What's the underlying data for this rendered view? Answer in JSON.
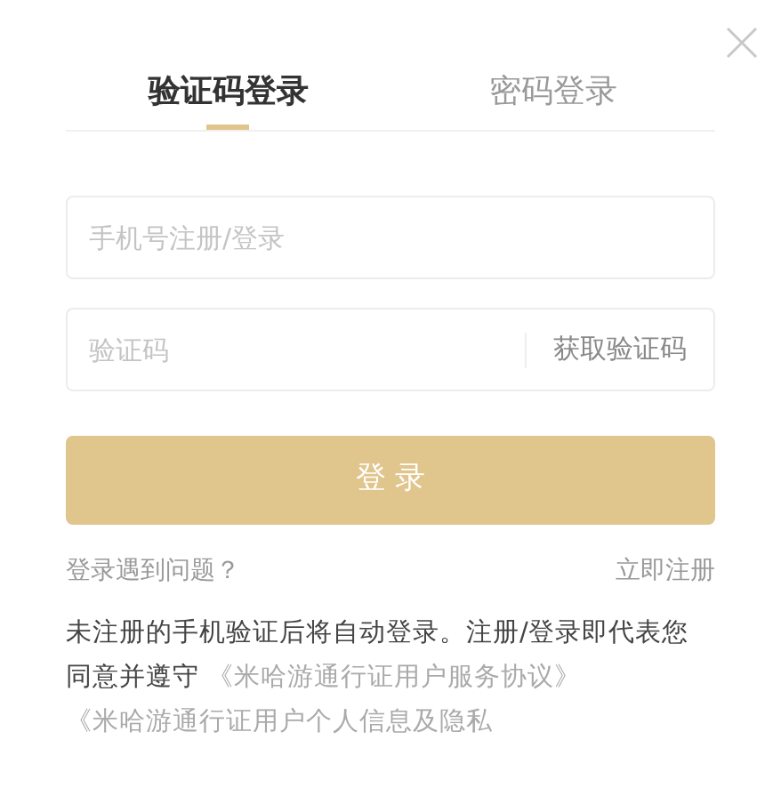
{
  "tabs": [
    {
      "label": "验证码登录",
      "selected": true
    },
    {
      "label": "密码登录",
      "selected": false
    }
  ],
  "phone_field": {
    "placeholder": "手机号注册/登录"
  },
  "code_field": {
    "placeholder": "验证码",
    "action": "获取验证码"
  },
  "login_button": "登 录",
  "help_link": "登录遇到问题？",
  "register_link": "立即注册",
  "agreement": [
    {
      "kind": "text",
      "text": "未注册的手机验证后将自动登录。注册/登录即代表您同意并遵守"
    },
    {
      "kind": "link",
      "text": "《米哈游通行证用户服务协议》"
    },
    {
      "kind": "link",
      "text": "《米哈游通行证用户个人信息及隐私"
    }
  ]
}
